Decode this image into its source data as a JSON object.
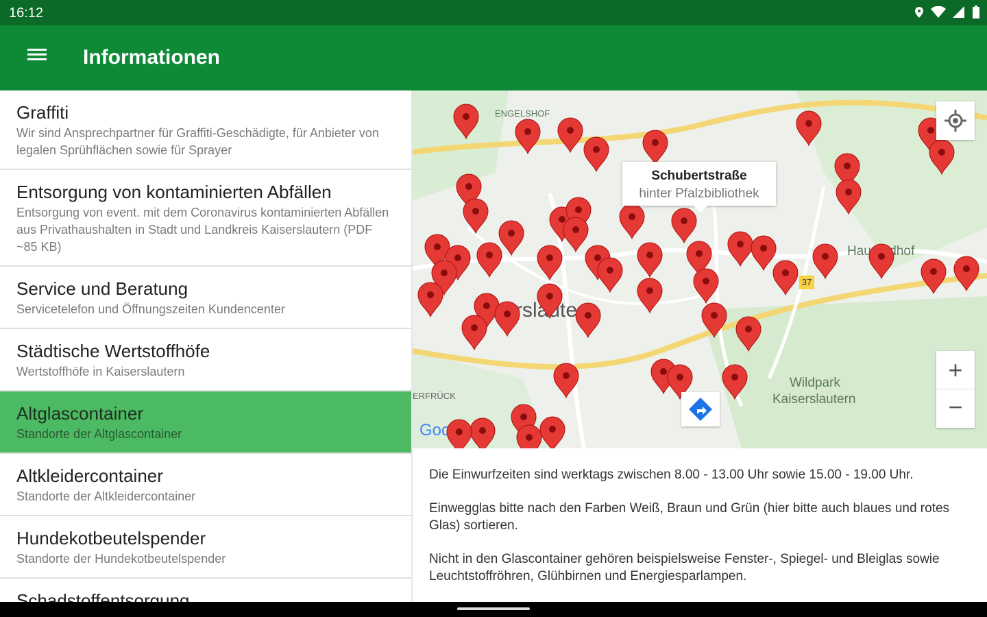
{
  "status": {
    "time": "16:12"
  },
  "appbar": {
    "title": "Informationen"
  },
  "list": [
    {
      "title": "Graffiti",
      "subtitle": "Wir sind Ansprechpartner für Graffiti-Geschädigte, für Anbieter von legalen Sprühflächen sowie für Sprayer"
    },
    {
      "title": "Entsorgung von kontaminierten Abfällen",
      "subtitle": "Entsorgung von event. mit dem Coronavirus kontaminierten Abfällen aus Privathaushalten in Stadt und Landkreis Kaiserslautern (PDF ~85 KB)"
    },
    {
      "title": "Service und Beratung",
      "subtitle": "Servicetelefon und Öffnungszeiten Kundencenter"
    },
    {
      "title": "Städtische Wertstoffhöfe",
      "subtitle": "Wertstoffhöfe in Kaiserslautern"
    },
    {
      "title": "Altglascontainer",
      "subtitle": "Standorte der Altglascontainer",
      "selected": true
    },
    {
      "title": "Altkleidercontainer",
      "subtitle": "Standorte der Altkleidercontainer"
    },
    {
      "title": "Hundekotbeutelspender",
      "subtitle": "Standorte der Hundekotbeutelspender"
    },
    {
      "title": "Schadstoffentsorgung",
      "subtitle": ""
    }
  ],
  "map": {
    "popup_title": "Schubertstraße",
    "popup_subtitle": "hinter Pfalzbibliothek",
    "labels": {
      "engelshof": "ENGELSHOF",
      "city": "rslaute",
      "wildpark1": "Wildpark",
      "wildpark2": "Kaiserslautern",
      "hauptfriedhof": "Hau    riedhof",
      "erfenbach": "ERFRÜCK",
      "google": "Google",
      "road": "37"
    },
    "zoom_in": "+",
    "zoom_out": "−",
    "accent": "#e53935"
  },
  "info": {
    "p1": "Die Einwurfzeiten sind werktags zwischen 8.00 - 13.00 Uhr sowie 15.00 - 19.00 Uhr.",
    "p2": "Einwegglas bitte nach den Farben Weiß, Braun und Grün (hier bitte auch blaues und rotes Glas) sortieren.",
    "p3": "Nicht in den Glascontainer gehören beispielsweise Fenster-, Spiegel- und Bleiglas sowie Leuchtstoffröhren, Glühbirnen und Energiesparlampen."
  }
}
